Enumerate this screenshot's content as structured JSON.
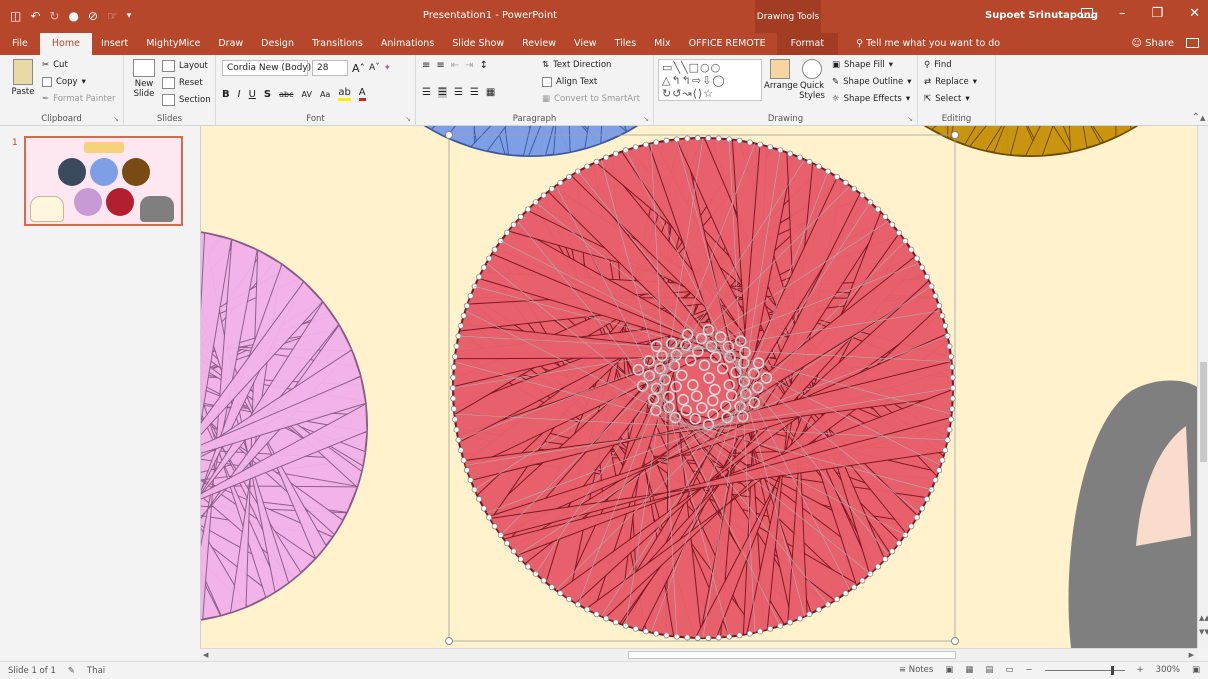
{
  "window": {
    "title": "Presentation1 - PowerPoint",
    "context_tab_group": "Drawing Tools",
    "user": "Supoet Srinutapong"
  },
  "tabs": [
    "File",
    "Home",
    "Insert",
    "MightyMice",
    "Draw",
    "Design",
    "Transitions",
    "Animations",
    "Slide Show",
    "Review",
    "View",
    "Tiles",
    "Mix",
    "OFFICE REMOTE"
  ],
  "active_tab": "Home",
  "format_tab": "Format",
  "tell_me": "Tell me what you want to do",
  "share": "Share",
  "ribbon": {
    "clipboard": {
      "label": "Clipboard",
      "paste": "Paste",
      "cut": "Cut",
      "copy": "Copy",
      "format_painter": "Format Painter"
    },
    "slides": {
      "label": "Slides",
      "new_slide": "New Slide",
      "layout": "Layout",
      "reset": "Reset",
      "section": "Section"
    },
    "font": {
      "label": "Font",
      "font_name": "Cordia New (Body)",
      "font_size": "28"
    },
    "paragraph": {
      "label": "Paragraph",
      "text_direction": "Text Direction",
      "align_text": "Align Text",
      "convert_smartart": "Convert to SmartArt"
    },
    "drawing": {
      "label": "Drawing",
      "arrange": "Arrange",
      "quick_styles": "Quick Styles",
      "shape_fill": "Shape Fill",
      "shape_outline": "Shape Outline",
      "shape_effects": "Shape Effects"
    },
    "editing": {
      "label": "Editing",
      "find": "Find",
      "replace": "Replace",
      "select": "Select"
    }
  },
  "slide_panel": {
    "slide_number": "1"
  },
  "status": {
    "slide": "Slide 1 of 1",
    "language": "Thai",
    "notes": "Notes",
    "zoom": "300%",
    "zoom_fraction": 0.86
  },
  "colors": {
    "accent": "#b7472a",
    "canvas_bg": "#fff2cc",
    "red_yarn": "#e8606b",
    "pink_yarn": "#f2b4e8",
    "blue_yarn": "#7e9fe6",
    "gold_yarn": "#c99410",
    "cat_gray": "#7f7f7f"
  }
}
